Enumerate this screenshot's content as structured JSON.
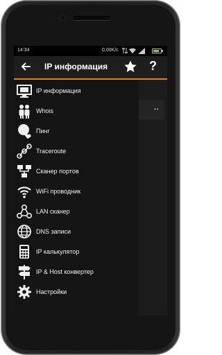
{
  "status": {
    "time": "14:34",
    "net_rate": "0,00K/c"
  },
  "appbar": {
    "title": "IP информация",
    "back_icon": "back-arrow-icon",
    "star_icon": "star-icon",
    "help_label": "?"
  },
  "menu": {
    "items": [
      {
        "label": "IP информация",
        "icon": "monitor-icon"
      },
      {
        "label": "Whois",
        "icon": "people-icon"
      },
      {
        "label": "Пинг",
        "icon": "ping-pong-icon"
      },
      {
        "label": "Traceroute",
        "icon": "route-icon"
      },
      {
        "label": "Сканер портов",
        "icon": "port-scanner-icon"
      },
      {
        "label": "WiFi проводник",
        "icon": "wifi-icon"
      },
      {
        "label": "LAN сканер",
        "icon": "lan-icon"
      },
      {
        "label": "DNS записи",
        "icon": "globe-icon"
      },
      {
        "label": "IP калькулятор",
        "icon": "calculator-icon"
      },
      {
        "label": "IP & Host конвертер",
        "icon": "signpost-icon"
      },
      {
        "label": "Настройки",
        "icon": "gear-icon"
      }
    ]
  },
  "colors": {
    "accent": "#e67e22",
    "drawer_bg": "#141414",
    "appbar_bg": "#1e1e1e"
  }
}
